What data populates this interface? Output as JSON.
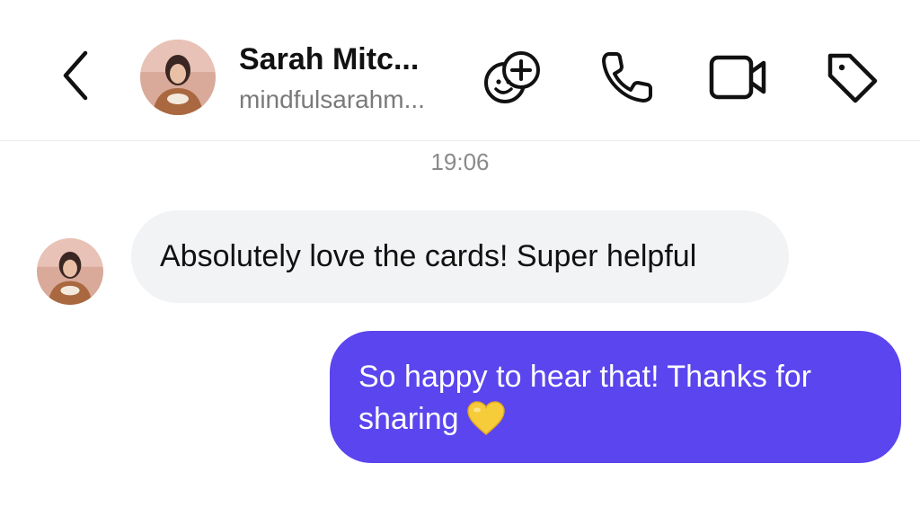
{
  "header": {
    "back_label": "Back",
    "contact_name": "Sarah Mitc...",
    "contact_handle": "mindfulsarahm...",
    "actions": [
      {
        "icon": "face-effects-icon"
      },
      {
        "icon": "phone-icon"
      },
      {
        "icon": "video-camera-icon"
      },
      {
        "icon": "tag-icon"
      }
    ]
  },
  "conversation": {
    "timestamp": "19:06",
    "messages": [
      {
        "direction": "incoming",
        "text": "Absolutely love the cards! Super helpful"
      },
      {
        "direction": "outgoing",
        "text": "So happy to hear that! Thanks for sharing",
        "emoji": "yellow-heart"
      }
    ]
  },
  "colors": {
    "accent": "#5b45ee",
    "incoming_bubble": "#f2f3f5",
    "heart": "#f7cc3a"
  }
}
